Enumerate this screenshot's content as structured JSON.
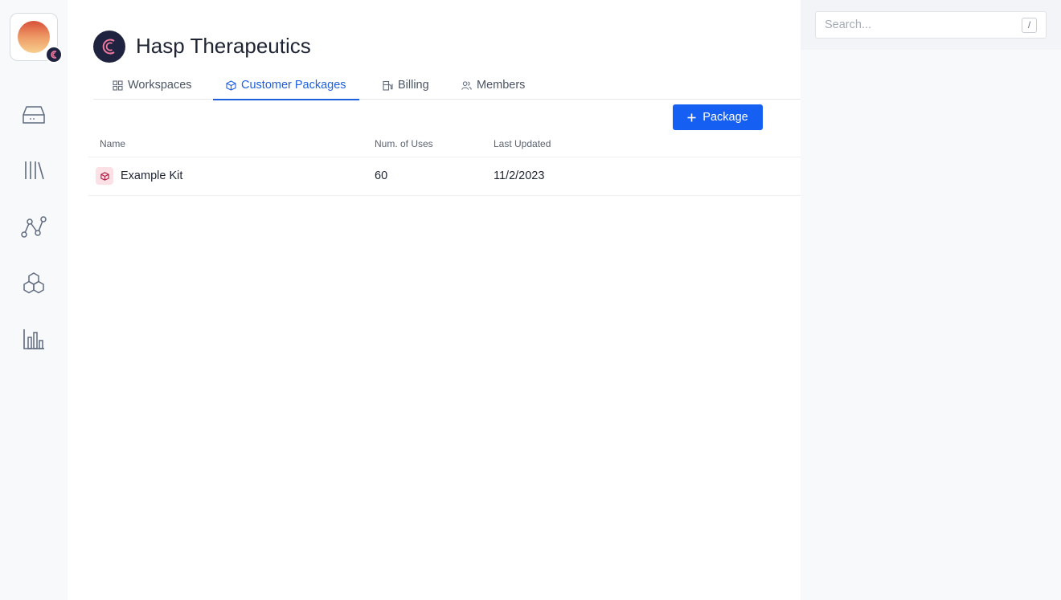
{
  "org": {
    "name": "Hasp Therapeutics",
    "avatar_icon": "sunset-logo",
    "badge_icon": "hasp-logo"
  },
  "rail": {
    "items": [
      {
        "icon": "inbox-icon"
      },
      {
        "icon": "library-icon"
      },
      {
        "icon": "workflow-icon"
      },
      {
        "icon": "hexagons-icon"
      },
      {
        "icon": "bar-chart-icon"
      }
    ]
  },
  "tabs": [
    {
      "label": "Workspaces",
      "icon": "grid-icon",
      "active": false
    },
    {
      "label": "Customer Packages",
      "icon": "package-icon",
      "active": true
    },
    {
      "label": "Billing",
      "icon": "fuel-icon",
      "active": false
    },
    {
      "label": "Members",
      "icon": "users-icon",
      "active": false
    }
  ],
  "actions": {
    "add_package_label": "Package"
  },
  "table": {
    "columns": [
      "Name",
      "Num. of Uses",
      "Last Updated"
    ],
    "rows": [
      {
        "name": "Example Kit",
        "uses": "60",
        "updated": "11/2/2023"
      }
    ]
  },
  "search": {
    "placeholder": "Search...",
    "shortcut": "/"
  },
  "colors": {
    "accent": "#1560f2",
    "active_tab": "#1d5fe0",
    "logo_bg": "#1f2340"
  }
}
